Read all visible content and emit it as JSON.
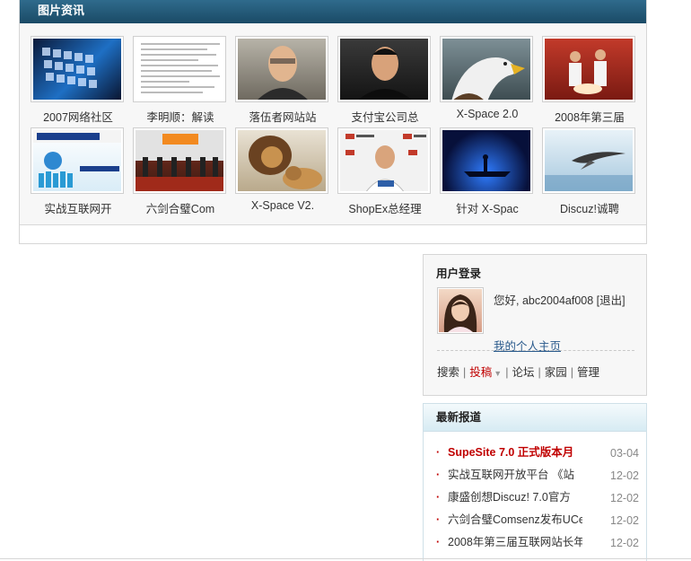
{
  "photo_panel": {
    "title": "图片资讯",
    "items": [
      {
        "caption": "2007网络社区",
        "icon": "conference-photo"
      },
      {
        "caption": "李明顺：解读",
        "icon": "document-photo"
      },
      {
        "caption": "落伍者网站站",
        "icon": "portrait-photo"
      },
      {
        "caption": "支付宝公司总",
        "icon": "portrait-photo"
      },
      {
        "caption": "X-Space 2.0",
        "icon": "eagle-photo"
      },
      {
        "caption": "2008年第三届",
        "icon": "ceremony-photo"
      },
      {
        "caption": "实战互联网开",
        "icon": "event-banner-photo"
      },
      {
        "caption": "六剑合璧Com",
        "icon": "stage-photo"
      },
      {
        "caption": "X-Space V2.",
        "icon": "lion-photo"
      },
      {
        "caption": "ShopEx总经理",
        "icon": "interview-photo"
      },
      {
        "caption": "针对 X-Spac",
        "icon": "boat-photo"
      },
      {
        "caption": "Discuz!诚聘",
        "icon": "bird-photo"
      }
    ]
  },
  "login": {
    "title": "用户登录",
    "greeting": "您好, abc2004af008 [退出]",
    "homepage_link": "我的个人主页",
    "nav": {
      "search": "搜索",
      "post": "投稿",
      "forum": "论坛",
      "home": "家园",
      "admin": "管理"
    }
  },
  "news": {
    "title": "最新报道",
    "items": [
      {
        "title": "SupeSite 7.0 正式版本月",
        "date": "03-04",
        "hot": true
      },
      {
        "title": "实战互联网开放平台 《站",
        "date": "12-02",
        "hot": false
      },
      {
        "title": "康盛创想Discuz! 7.0官方",
        "date": "12-02",
        "hot": false
      },
      {
        "title": "六剑合璧Comsenz发布UCe",
        "date": "12-02",
        "hot": false
      },
      {
        "title": "2008年第三届互联网站长年",
        "date": "12-02",
        "hot": false
      }
    ]
  },
  "colors": {
    "header_bg": "#1f5676",
    "accent_red": "#c00000",
    "link_blue": "#2a5a8c"
  }
}
